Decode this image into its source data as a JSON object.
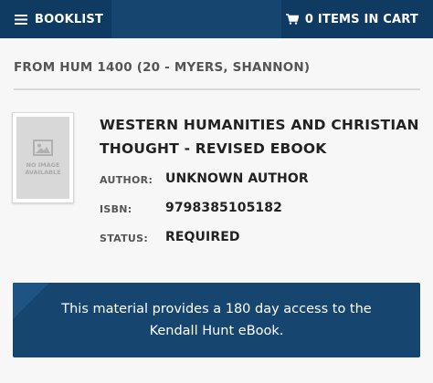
{
  "nav": {
    "booklist_label": "BOOKLIST",
    "cart_label": "0 ITEMS IN CART"
  },
  "section": {
    "title": "FROM HUM 1400 (20 - MYERS, SHANNON)"
  },
  "book": {
    "thumbnail_text": "NO IMAGE AVAILABLE",
    "title": "WESTERN HUMANITIES AND CHRISTIAN THOUGHT - REVISED EBOOK",
    "author_label": "AUTHOR:",
    "author_value": "UNKNOWN AUTHOR",
    "isbn_label": "ISBN:",
    "isbn_value": "9798385105182",
    "status_label": "STATUS:",
    "status_value": "REQUIRED"
  },
  "notice": {
    "text": "This material provides a 180 day access to the Kendall Hunt eBook."
  },
  "colors": {
    "nav_bar": "#16466f",
    "nav_tab": "#0f3b62",
    "notice_bg": "#16466f",
    "page_bg": "#f7f7f7"
  },
  "icons": {
    "booklist": "menu-icon",
    "cart": "cart-icon",
    "thumbnail": "image-icon"
  }
}
